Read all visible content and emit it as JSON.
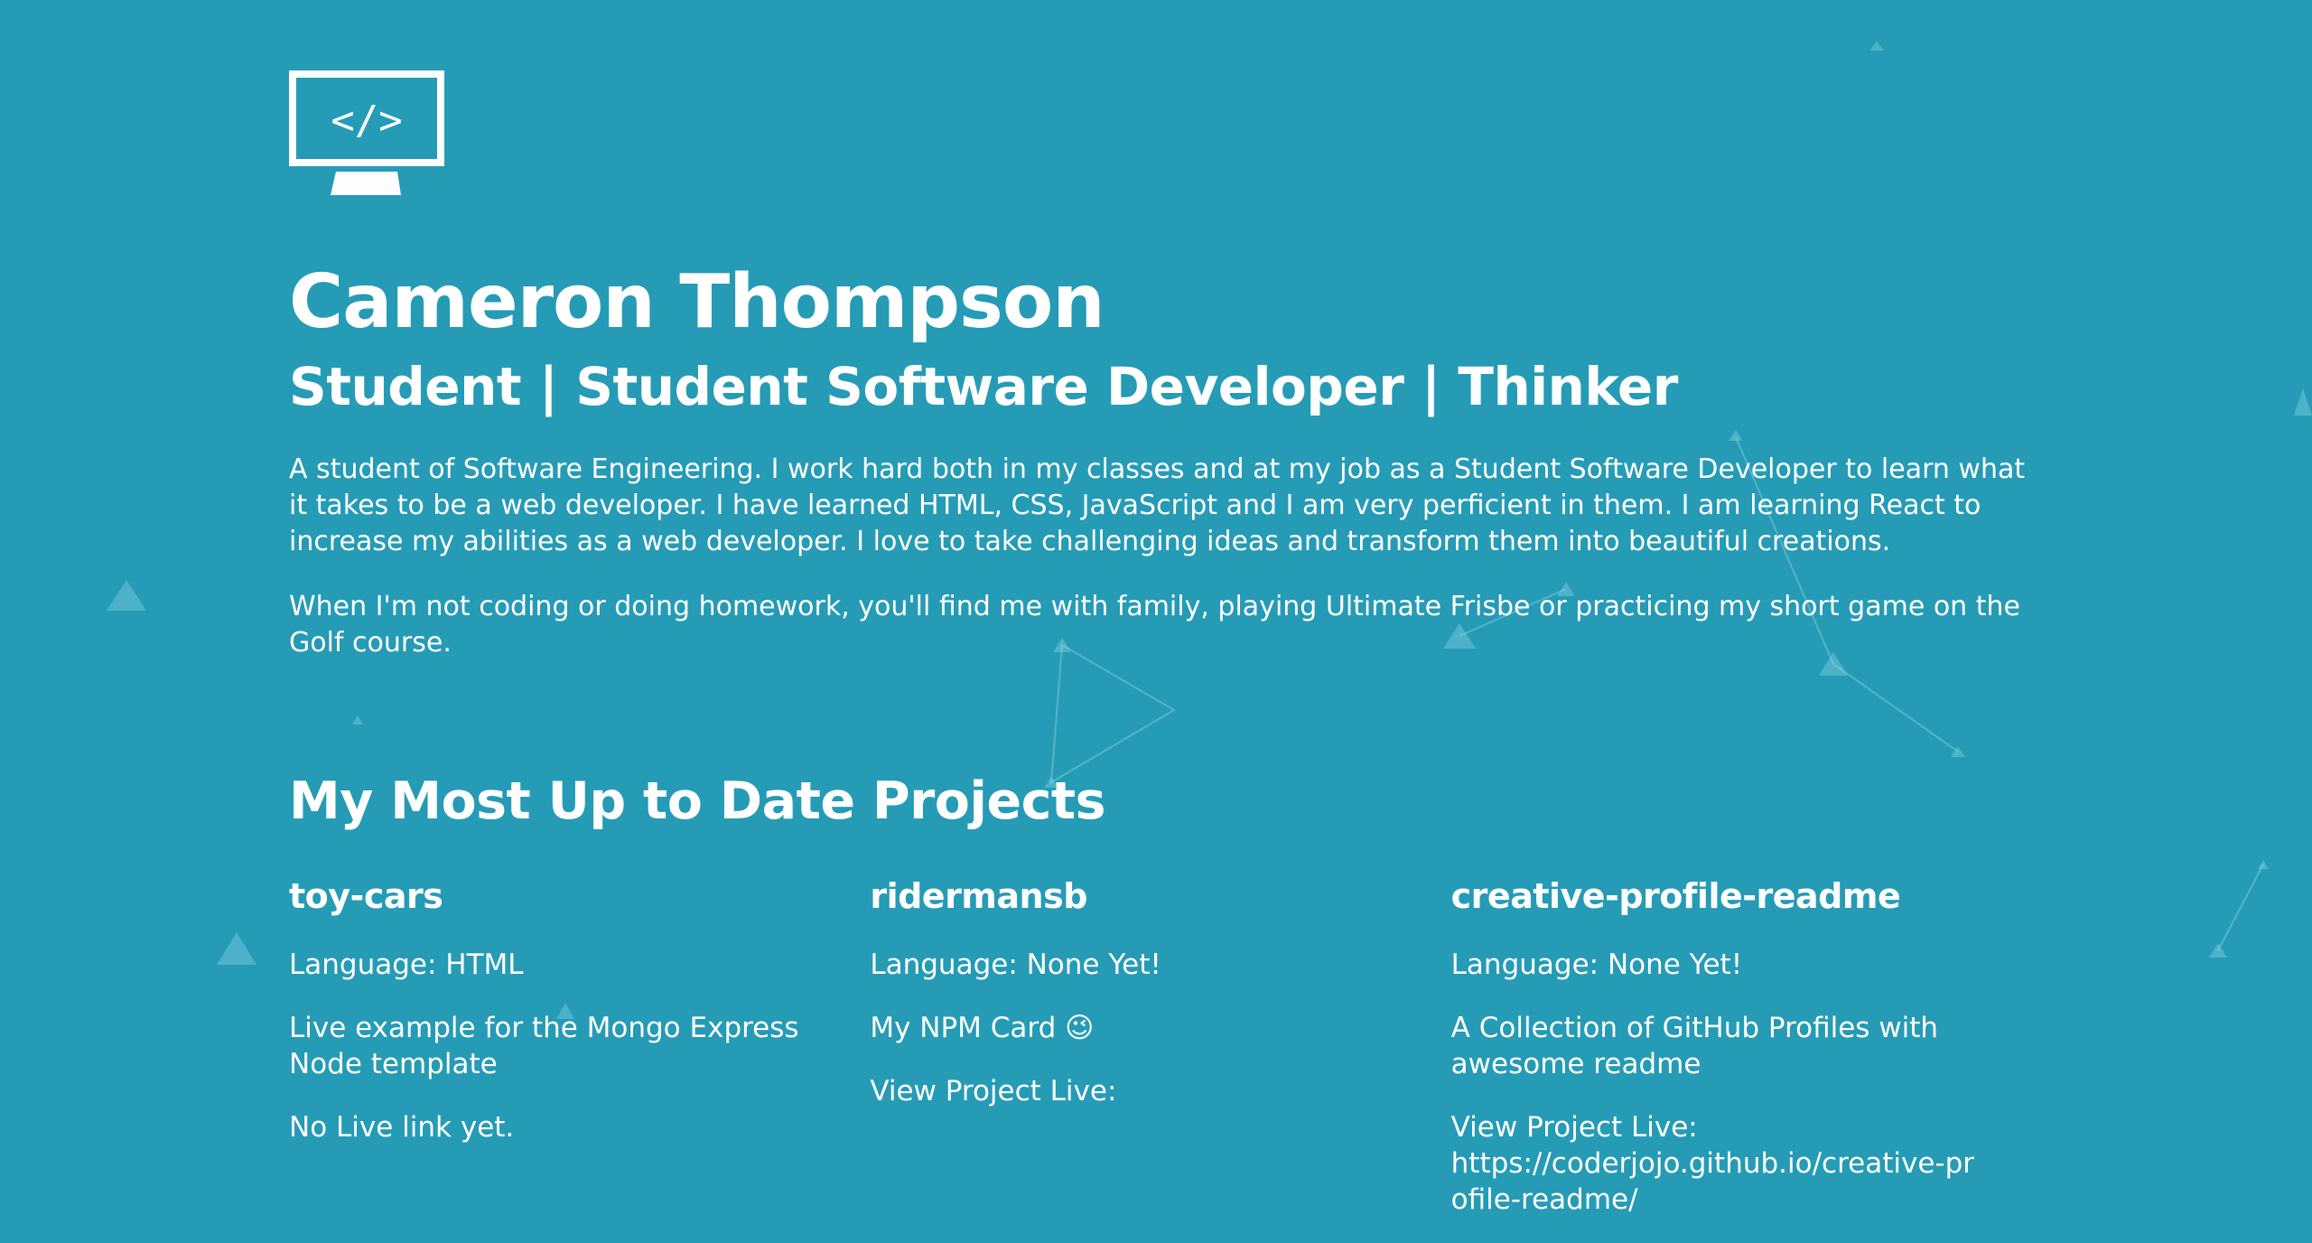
{
  "header": {
    "logo_icon": "code-monitor-icon",
    "name": "Cameron Thompson",
    "tagline": "Student | Student Software Developer | Thinker"
  },
  "bio": {
    "paragraph1": "A student of Software Engineering. I work hard both in my classes and at my job as a Student Software Developer to learn what it takes to be a web developer. I have learned HTML, CSS, JavaScript and I am very perficient in them. I am learning React to increase my abilities as a web developer. I love to take challenging ideas and transform them into beautiful creations.",
    "paragraph2": "When I'm not coding or doing homework, you'll find me with family, playing Ultimate Frisbe or practicing my short game on the Golf course."
  },
  "projects_section": {
    "heading": "My Most Up to Date Projects",
    "items": [
      {
        "title": "toy-cars",
        "language": "Language: HTML",
        "description": "Live example for the Mongo Express Node template",
        "live": "No Live link yet.",
        "live_url": ""
      },
      {
        "title": "ridermansb",
        "language": "Language: None Yet!",
        "description": "My NPM Card 😉",
        "live": "View Project Live:",
        "live_url": ""
      },
      {
        "title": "creative-profile-readme",
        "language": "Language: None Yet!",
        "description": "A Collection of GitHub Profiles with awesome readme",
        "live": "View Project Live:",
        "live_url": "https://coderjojo.github.io/creative-profile-readme/"
      }
    ]
  },
  "colors": {
    "background": "#259bb6",
    "text": "#ffffff",
    "particle": "#8fd3e3"
  }
}
